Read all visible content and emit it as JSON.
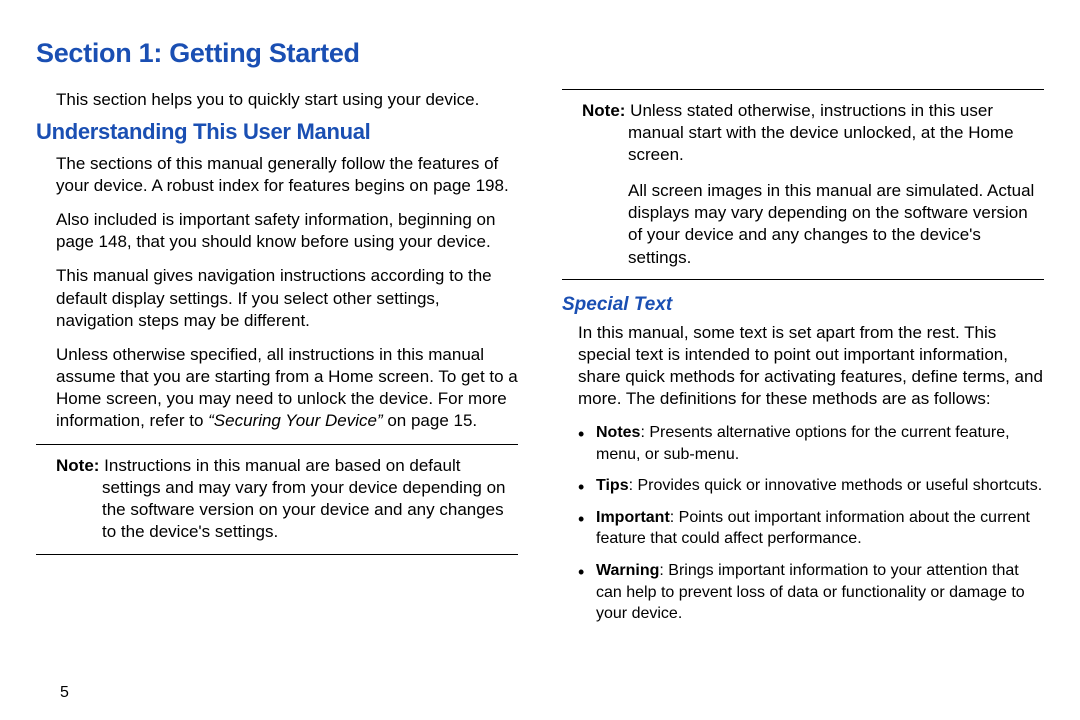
{
  "section_title": "Section 1: Getting Started",
  "left": {
    "intro": "This section helps you to quickly start using your device.",
    "heading": "Understanding This User Manual",
    "p1": "The sections of this manual generally follow the features of your device. A robust index for features begins on page 198.",
    "p2": "Also included is important safety information, beginning on page 148, that you should know before using your device.",
    "p3": "This manual gives navigation instructions according to the default display settings. If you select other settings, navigation steps may be different.",
    "p4_a": "Unless otherwise specified, all instructions in this manual assume that you are starting from a Home screen. To get to a Home screen, you may need to unlock the device. For more information, refer to ",
    "p4_quote": "“Securing Your Device”",
    "p4_b": " on page 15.",
    "note_label": "Note: ",
    "note_body": "Instructions in this manual are based on default settings and may vary from your device depending on the software version on your device and any changes to the device's settings."
  },
  "right": {
    "note1_label": "Note: ",
    "note1_body": "Unless stated otherwise, instructions in this user manual start with the device unlocked, at the Home screen.",
    "note1_extra": "All screen images in this manual are simulated. Actual displays may vary depending on the software version of your device and any changes to the device's settings.",
    "heading": "Special Text",
    "p1": "In this manual, some text is set apart from the rest. This special text is intended to point out important information, share quick methods for activating features, define terms, and more. The definitions for these methods are as follows:",
    "bullets": {
      "b1_label": "Notes",
      "b1_body": ": Presents alternative options for the current feature, menu, or sub-menu.",
      "b2_label": "Tips",
      "b2_body": ": Provides quick or innovative methods or useful shortcuts.",
      "b3_label": "Important",
      "b3_body": ": Points out important information about the current feature that could affect performance.",
      "b4_label": "Warning",
      "b4_body": ": Brings important information to your attention that can help to prevent loss of data or functionality or damage to your device."
    }
  },
  "page_number": "5"
}
